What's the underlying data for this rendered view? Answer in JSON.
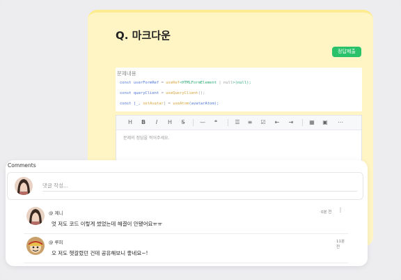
{
  "question": {
    "title": "Q. 마크다운",
    "submit_label": "정답제출"
  },
  "problem": {
    "label": "문제내용",
    "code": [
      [
        {
          "t": "const ",
          "c": "c-kw"
        },
        {
          "t": "userFormRef",
          "c": "c-var"
        },
        {
          "t": " = ",
          "c": "c-op"
        },
        {
          "t": "useRef",
          "c": "c-fn"
        },
        {
          "t": "<HTMLFormElement",
          "c": "c-ty"
        },
        {
          "t": " | null",
          "c": "c-op"
        },
        {
          "t": ">(null);",
          "c": "c-ty"
        }
      ],
      [
        {
          "t": "const ",
          "c": "c-kw"
        },
        {
          "t": "queryClient",
          "c": "c-var"
        },
        {
          "t": " = ",
          "c": "c-op"
        },
        {
          "t": "useQueryClient",
          "c": "c-fn"
        },
        {
          "t": "();",
          "c": "c-op"
        }
      ],
      [
        {
          "t": "const ",
          "c": "c-kw"
        },
        {
          "t": "[_, ",
          "c": "c-var"
        },
        {
          "t": "setAvatar",
          "c": "c-fn"
        },
        {
          "t": "] = ",
          "c": "c-op"
        },
        {
          "t": "useAtom",
          "c": "c-fn"
        },
        {
          "t": "(avatarAtom);",
          "c": "c-var"
        }
      ]
    ]
  },
  "editor": {
    "placeholder": "문제의 정답을 적어주세요.",
    "toolbar": [
      {
        "name": "heading-icon",
        "glyph": "H"
      },
      {
        "name": "bold-icon",
        "glyph": "B"
      },
      {
        "name": "italic-icon",
        "glyph": "I"
      },
      {
        "name": "heading-alt-icon",
        "glyph": "H"
      },
      {
        "name": "strikethrough-icon",
        "glyph": "S̶"
      },
      {
        "name": "horizontal-rule-icon",
        "glyph": "—"
      },
      {
        "name": "quote-icon",
        "glyph": "❝"
      },
      {
        "name": "bullet-list-icon",
        "glyph": "☰"
      },
      {
        "name": "ordered-list-icon",
        "glyph": "≡"
      },
      {
        "name": "task-list-icon",
        "glyph": "☑"
      },
      {
        "name": "outdent-icon",
        "glyph": "⇤"
      },
      {
        "name": "indent-icon",
        "glyph": "⇥"
      },
      {
        "name": "table-icon",
        "glyph": "▦"
      },
      {
        "name": "image-icon",
        "glyph": "▣"
      },
      {
        "name": "more-icon",
        "glyph": "⋯"
      }
    ]
  },
  "comments": {
    "title": "Comments",
    "input_placeholder": "댓글 작성...",
    "items": [
      {
        "user": "@ 제니",
        "time": "0분 전",
        "text": "엇 저도 코드 이렇게 썼었는데 해결이 안됐어요ㅠㅠ",
        "more": "⋮"
      },
      {
        "user": "@ 루피",
        "time": "11분 전",
        "text": "오 저도 헷갈렸던 건데 공유해보니 좋네요~!"
      }
    ]
  },
  "colors": {
    "accent": "#2ac16b",
    "card_yellow": "#fff5c4"
  }
}
